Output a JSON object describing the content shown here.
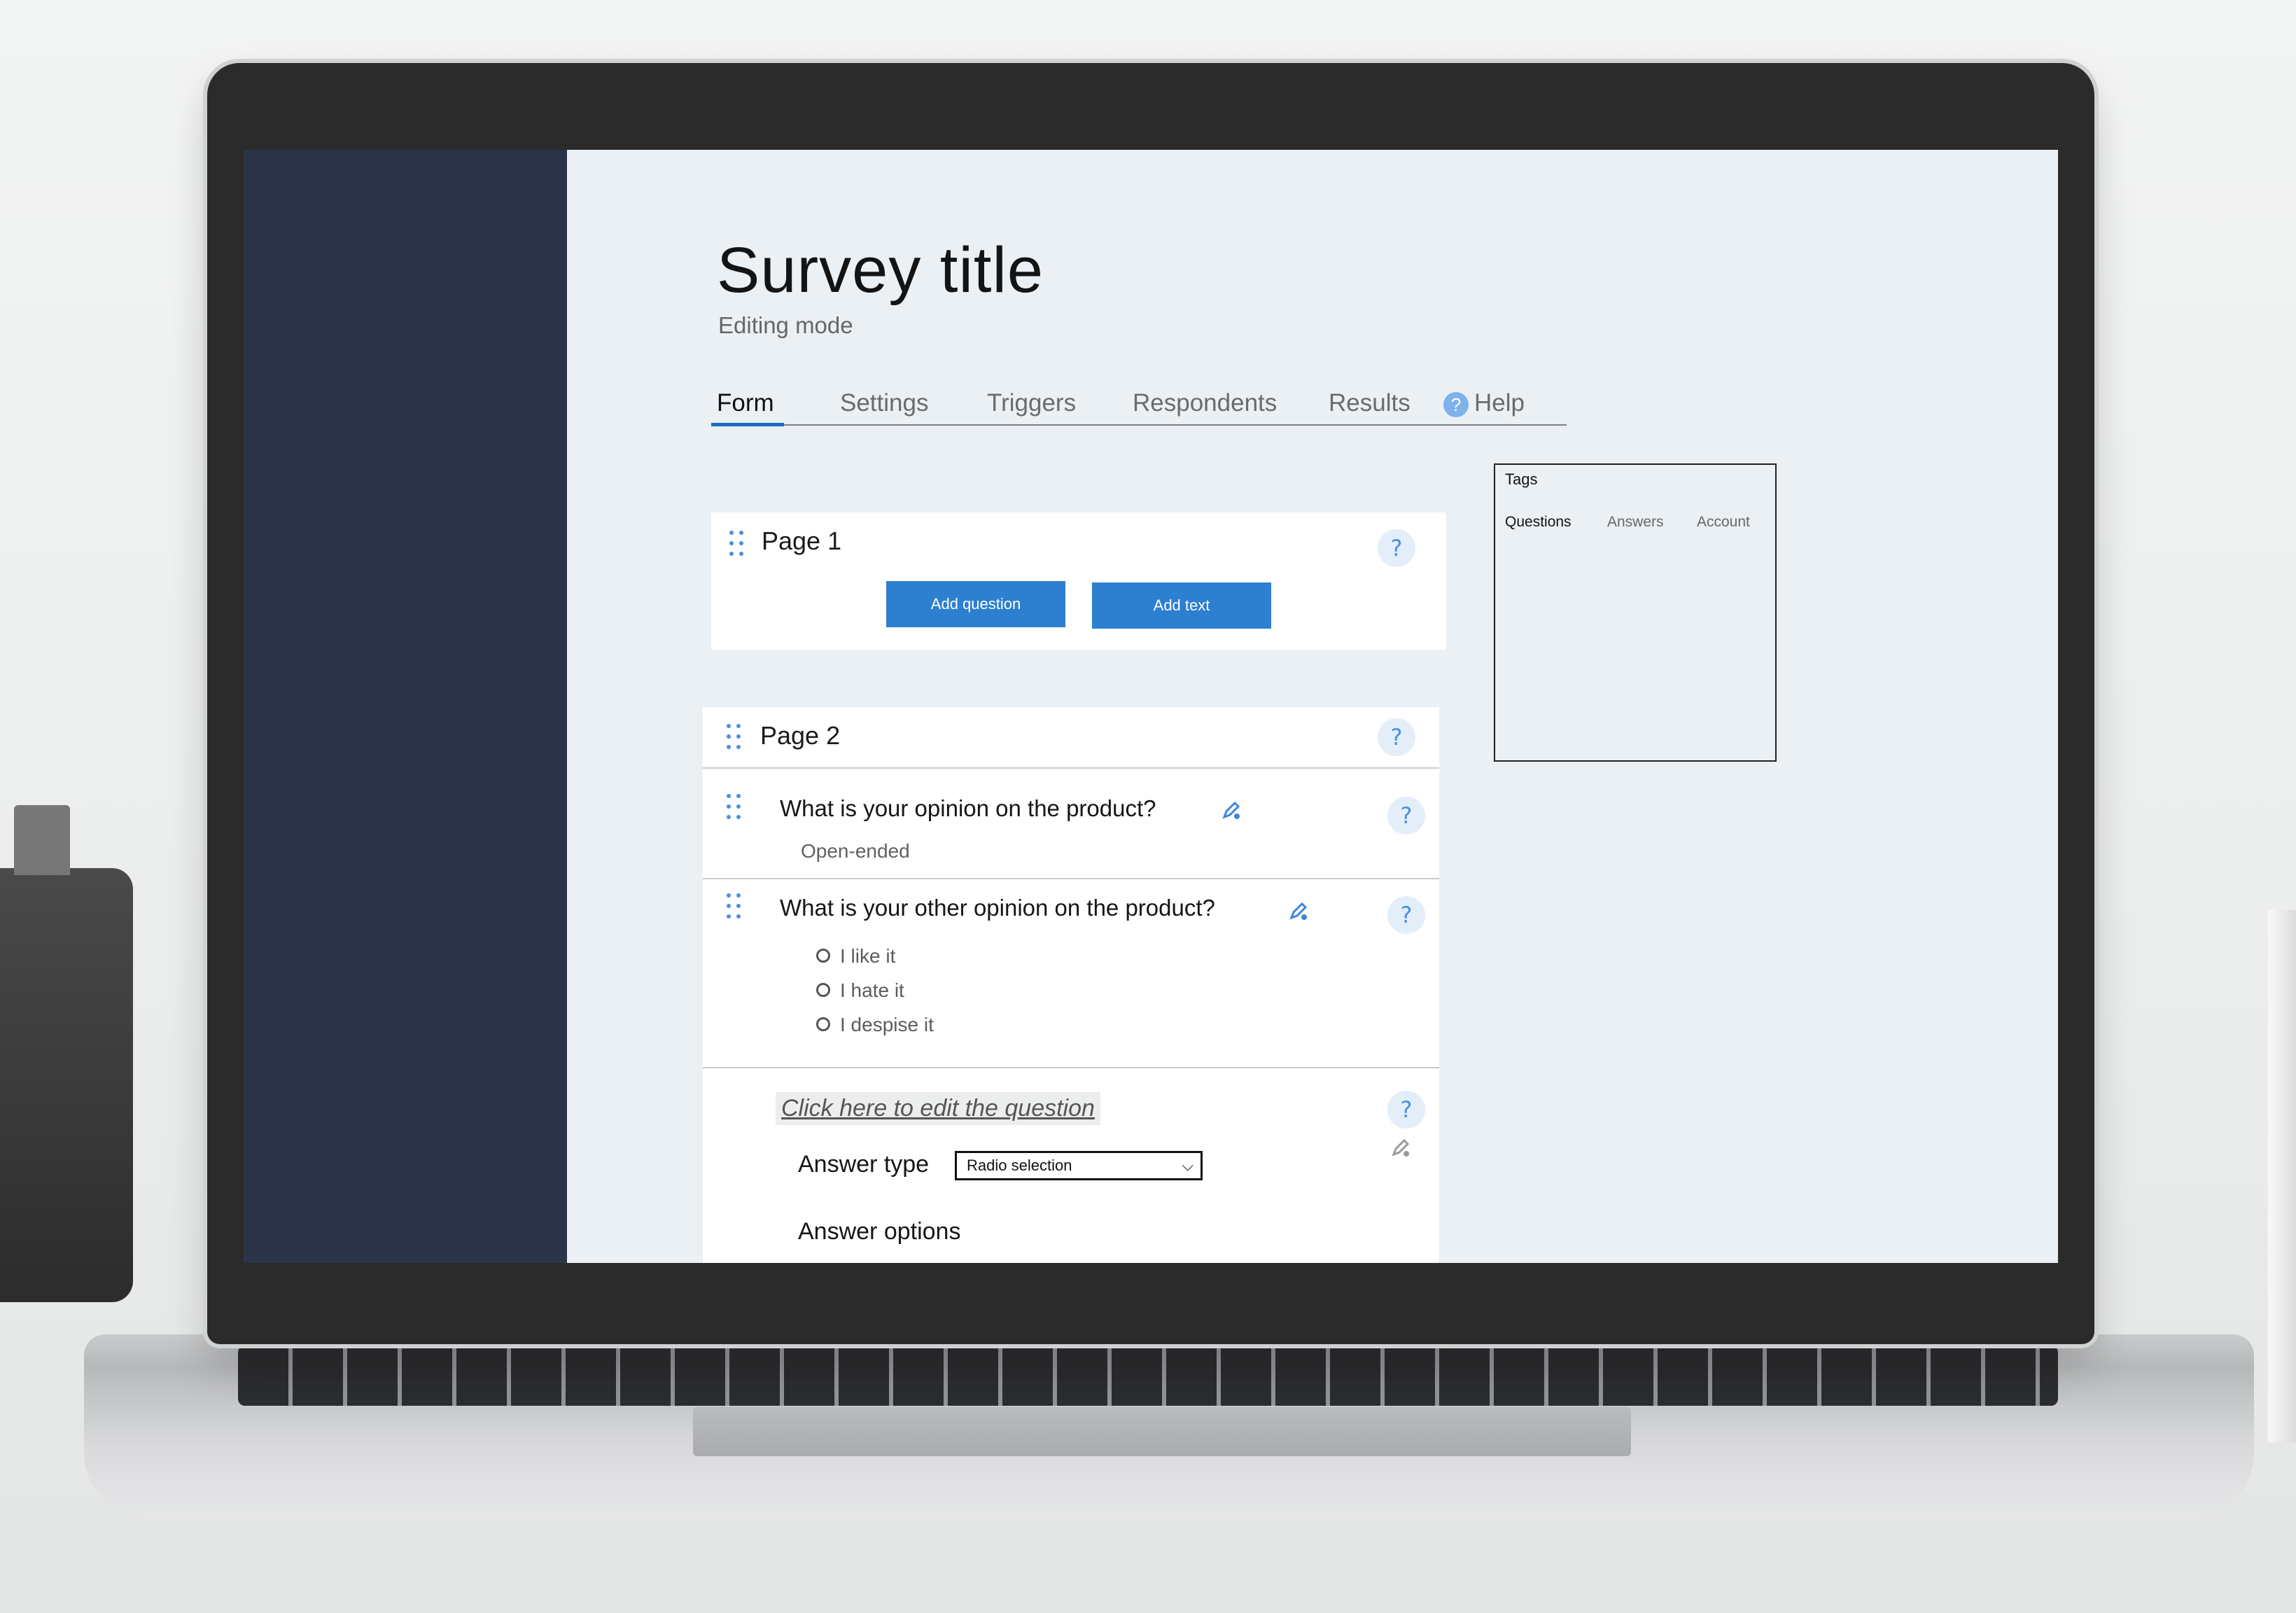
{
  "header": {
    "title": "Survey title",
    "subtitle": "Editing mode"
  },
  "tabs": [
    {
      "label": "Form",
      "active": true
    },
    {
      "label": "Settings"
    },
    {
      "label": "Triggers"
    },
    {
      "label": "Respondents"
    },
    {
      "label": "Results"
    },
    {
      "label": "Help",
      "icon": "help-circle-icon"
    }
  ],
  "pages": [
    {
      "title": "Page 1",
      "buttons": {
        "add_question": "Add question",
        "add_text": "Add text"
      },
      "help": "?"
    },
    {
      "title": "Page 2",
      "help": "?",
      "questions": [
        {
          "text": "What is your opinion on the product?",
          "type_label": "Open-ended",
          "help": "?"
        },
        {
          "text": "What is your other opinion on the product?",
          "help": "?",
          "options": [
            "I like it",
            "I hate it",
            "I despise it"
          ]
        }
      ],
      "editor": {
        "placeholder": "Click here to edit the question",
        "answer_type_label": "Answer type",
        "answer_type_value": "Radio selection",
        "answer_options_label": "Answer options",
        "help": "?"
      }
    }
  ],
  "tags_panel": {
    "title": "Tags",
    "tabs": [
      {
        "label": "Questions",
        "active": true
      },
      {
        "label": "Answers"
      },
      {
        "label": "Account"
      }
    ]
  },
  "colors": {
    "sidebar": "#2c3548",
    "accent": "#2d7fd0",
    "background": "#ebf0f4"
  }
}
